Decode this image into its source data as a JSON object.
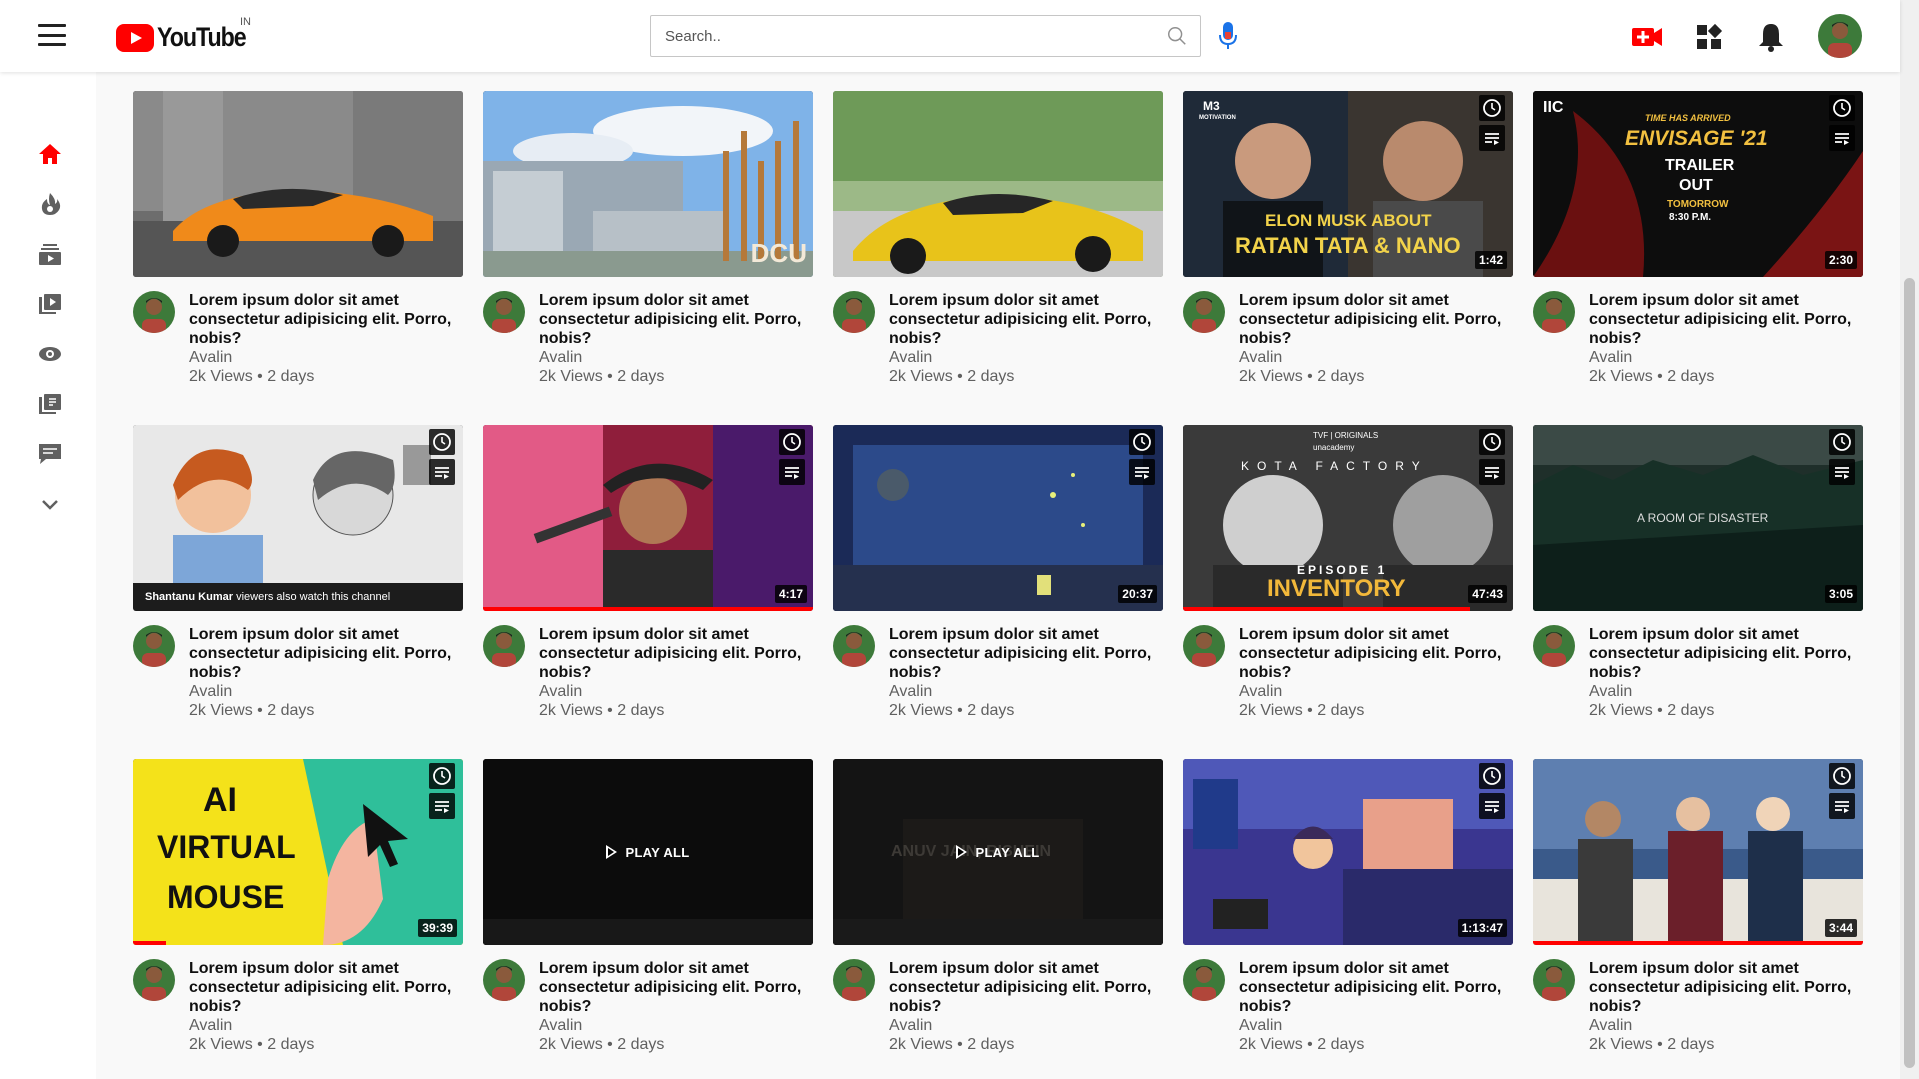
{
  "header": {
    "logo_text": "YouTube",
    "region": "IN",
    "search_placeholder": "Search..",
    "icons": [
      "menu-icon",
      "search-icon",
      "mic-icon",
      "create-video-icon",
      "apps-icon",
      "notifications-icon",
      "user-avatar"
    ]
  },
  "sidebar": {
    "icons": [
      "home-icon",
      "trending-icon",
      "subscriptions-icon",
      "library-icon",
      "history-icon",
      "playlist-icon",
      "feedback-icon",
      "chevron-down-icon"
    ],
    "accent": "#ff0000"
  },
  "cards": [
    {
      "title": "Lorem ipsum dolor sit amet consectetur adipisicing elit. Porro, nobis?",
      "channel": "Avalin",
      "stats": "2k Views • 2 days"
    },
    {
      "title": "Lorem ipsum dolor sit amet consectetur adipisicing elit. Porro, nobis?",
      "channel": "Avalin",
      "stats": "2k Views • 2 days",
      "overlay": "DCU"
    },
    {
      "title": "Lorem ipsum dolor sit amet consectetur adipisicing elit. Porro, nobis?",
      "channel": "Avalin",
      "stats": "2k Views • 2 days"
    },
    {
      "title": "Lorem ipsum dolor sit amet consectetur adipisicing elit. Porro, nobis?",
      "channel": "Avalin",
      "stats": "2k Views • 2 days",
      "duration": "1:42",
      "overlay": "ELON MUSK ABOUT",
      "overlay2": "RATAN TATA & NANO",
      "overlay3": "M3",
      "overlay4": "MOTIVATION"
    },
    {
      "title": "Lorem ipsum dolor sit amet consectetur adipisicing elit. Porro, nobis?",
      "channel": "Avalin",
      "stats": "2k Views • 2 days",
      "duration": "2:30",
      "overlay": "ENVISAGE '21",
      "overlay2": "TRAILER",
      "overlay3": "OUT",
      "overlay4": "TOMORROW",
      "overlay5": "8:30 P.M.",
      "overlay6": "TIME HAS ARRIVED",
      "overlay7": "IIC"
    },
    {
      "title": "Lorem ipsum dolor sit amet consectetur adipisicing elit. Porro, nobis?",
      "channel": "Avalin",
      "stats": "2k Views • 2 days",
      "overlay_name": "Shantanu Kumar",
      "overlay": " viewers also watch this channel"
    },
    {
      "title": "Lorem ipsum dolor sit amet consectetur adipisicing elit. Porro, nobis?",
      "channel": "Avalin",
      "stats": "2k Views • 2 days",
      "duration": "4:17",
      "progress": 1.0
    },
    {
      "title": "Lorem ipsum dolor sit amet consectetur adipisicing elit. Porro, nobis?",
      "channel": "Avalin",
      "stats": "2k Views • 2 days",
      "duration": "20:37"
    },
    {
      "title": "Lorem ipsum dolor sit amet consectetur adipisicing elit. Porro, nobis?",
      "channel": "Avalin",
      "stats": "2k Views • 2 days",
      "duration": "47:43",
      "progress": 0.87,
      "overlay": "EPISODE 1",
      "overlay2": "INVENTORY",
      "overlay3": "KOTA FACTORY",
      "overlay4": "TVF | ORIGINALS",
      "overlay5": "unacademy"
    },
    {
      "title": "Lorem ipsum dolor sit amet consectetur adipisicing elit. Porro, nobis?",
      "channel": "Avalin",
      "stats": "2k Views • 2 days",
      "duration": "3:05",
      "overlay": "A ROOM OF DISASTER"
    },
    {
      "title": "Lorem ipsum dolor sit amet consectetur adipisicing elit. Porro, nobis?",
      "channel": "Avalin",
      "stats": "2k Views • 2 days",
      "duration": "39:39",
      "progress": 0.1,
      "overlay": "AI",
      "overlay2": "VIRTUAL",
      "overlay3": "MOUSE"
    },
    {
      "title": "Lorem ipsum dolor sit amet consectetur adipisicing elit. Porro, nobis?",
      "channel": "Avalin",
      "stats": "2k Views • 2 days",
      "play_all": "PLAY ALL"
    },
    {
      "title": "Lorem ipsum dolor sit amet consectetur adipisicing elit. Porro, nobis?",
      "channel": "Avalin",
      "stats": "2k Views • 2 days",
      "play_all": "PLAY ALL",
      "overlay": "ANUV JAIN, RISHEIN"
    },
    {
      "title": "Lorem ipsum dolor sit amet consectetur adipisicing elit. Porro, nobis?",
      "channel": "Avalin",
      "stats": "2k Views • 2 days",
      "duration": "1:13:47"
    },
    {
      "title": "Lorem ipsum dolor sit amet consectetur adipisicing elit. Porro, nobis?",
      "channel": "Avalin",
      "stats": "2k Views • 2 days",
      "duration": "3:44",
      "progress": 1.0
    }
  ]
}
